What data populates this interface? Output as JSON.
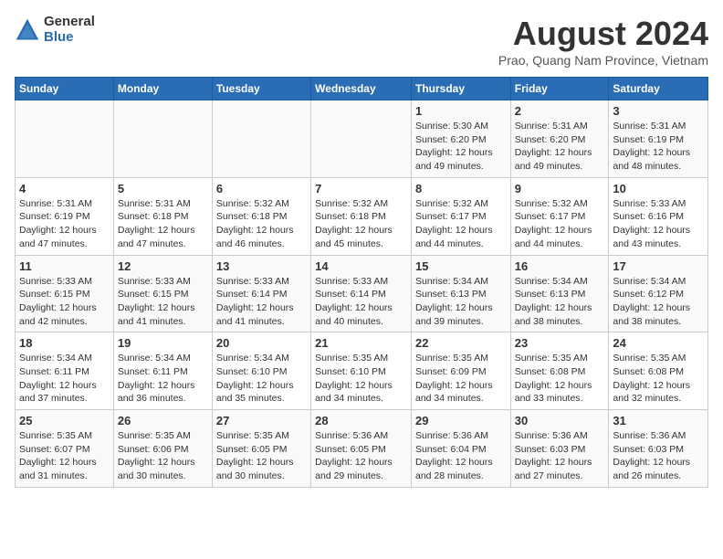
{
  "logo": {
    "general": "General",
    "blue": "Blue"
  },
  "title": "August 2024",
  "subtitle": "Prao, Quang Nam Province, Vietnam",
  "days_of_week": [
    "Sunday",
    "Monday",
    "Tuesday",
    "Wednesday",
    "Thursday",
    "Friday",
    "Saturday"
  ],
  "weeks": [
    [
      {
        "day": "",
        "info": ""
      },
      {
        "day": "",
        "info": ""
      },
      {
        "day": "",
        "info": ""
      },
      {
        "day": "",
        "info": ""
      },
      {
        "day": "1",
        "info": "Sunrise: 5:30 AM\nSunset: 6:20 PM\nDaylight: 12 hours\nand 49 minutes."
      },
      {
        "day": "2",
        "info": "Sunrise: 5:31 AM\nSunset: 6:20 PM\nDaylight: 12 hours\nand 49 minutes."
      },
      {
        "day": "3",
        "info": "Sunrise: 5:31 AM\nSunset: 6:19 PM\nDaylight: 12 hours\nand 48 minutes."
      }
    ],
    [
      {
        "day": "4",
        "info": "Sunrise: 5:31 AM\nSunset: 6:19 PM\nDaylight: 12 hours\nand 47 minutes."
      },
      {
        "day": "5",
        "info": "Sunrise: 5:31 AM\nSunset: 6:18 PM\nDaylight: 12 hours\nand 47 minutes."
      },
      {
        "day": "6",
        "info": "Sunrise: 5:32 AM\nSunset: 6:18 PM\nDaylight: 12 hours\nand 46 minutes."
      },
      {
        "day": "7",
        "info": "Sunrise: 5:32 AM\nSunset: 6:18 PM\nDaylight: 12 hours\nand 45 minutes."
      },
      {
        "day": "8",
        "info": "Sunrise: 5:32 AM\nSunset: 6:17 PM\nDaylight: 12 hours\nand 44 minutes."
      },
      {
        "day": "9",
        "info": "Sunrise: 5:32 AM\nSunset: 6:17 PM\nDaylight: 12 hours\nand 44 minutes."
      },
      {
        "day": "10",
        "info": "Sunrise: 5:33 AM\nSunset: 6:16 PM\nDaylight: 12 hours\nand 43 minutes."
      }
    ],
    [
      {
        "day": "11",
        "info": "Sunrise: 5:33 AM\nSunset: 6:15 PM\nDaylight: 12 hours\nand 42 minutes."
      },
      {
        "day": "12",
        "info": "Sunrise: 5:33 AM\nSunset: 6:15 PM\nDaylight: 12 hours\nand 41 minutes."
      },
      {
        "day": "13",
        "info": "Sunrise: 5:33 AM\nSunset: 6:14 PM\nDaylight: 12 hours\nand 41 minutes."
      },
      {
        "day": "14",
        "info": "Sunrise: 5:33 AM\nSunset: 6:14 PM\nDaylight: 12 hours\nand 40 minutes."
      },
      {
        "day": "15",
        "info": "Sunrise: 5:34 AM\nSunset: 6:13 PM\nDaylight: 12 hours\nand 39 minutes."
      },
      {
        "day": "16",
        "info": "Sunrise: 5:34 AM\nSunset: 6:13 PM\nDaylight: 12 hours\nand 38 minutes."
      },
      {
        "day": "17",
        "info": "Sunrise: 5:34 AM\nSunset: 6:12 PM\nDaylight: 12 hours\nand 38 minutes."
      }
    ],
    [
      {
        "day": "18",
        "info": "Sunrise: 5:34 AM\nSunset: 6:11 PM\nDaylight: 12 hours\nand 37 minutes."
      },
      {
        "day": "19",
        "info": "Sunrise: 5:34 AM\nSunset: 6:11 PM\nDaylight: 12 hours\nand 36 minutes."
      },
      {
        "day": "20",
        "info": "Sunrise: 5:34 AM\nSunset: 6:10 PM\nDaylight: 12 hours\nand 35 minutes."
      },
      {
        "day": "21",
        "info": "Sunrise: 5:35 AM\nSunset: 6:10 PM\nDaylight: 12 hours\nand 34 minutes."
      },
      {
        "day": "22",
        "info": "Sunrise: 5:35 AM\nSunset: 6:09 PM\nDaylight: 12 hours\nand 34 minutes."
      },
      {
        "day": "23",
        "info": "Sunrise: 5:35 AM\nSunset: 6:08 PM\nDaylight: 12 hours\nand 33 minutes."
      },
      {
        "day": "24",
        "info": "Sunrise: 5:35 AM\nSunset: 6:08 PM\nDaylight: 12 hours\nand 32 minutes."
      }
    ],
    [
      {
        "day": "25",
        "info": "Sunrise: 5:35 AM\nSunset: 6:07 PM\nDaylight: 12 hours\nand 31 minutes."
      },
      {
        "day": "26",
        "info": "Sunrise: 5:35 AM\nSunset: 6:06 PM\nDaylight: 12 hours\nand 30 minutes."
      },
      {
        "day": "27",
        "info": "Sunrise: 5:35 AM\nSunset: 6:05 PM\nDaylight: 12 hours\nand 30 minutes."
      },
      {
        "day": "28",
        "info": "Sunrise: 5:36 AM\nSunset: 6:05 PM\nDaylight: 12 hours\nand 29 minutes."
      },
      {
        "day": "29",
        "info": "Sunrise: 5:36 AM\nSunset: 6:04 PM\nDaylight: 12 hours\nand 28 minutes."
      },
      {
        "day": "30",
        "info": "Sunrise: 5:36 AM\nSunset: 6:03 PM\nDaylight: 12 hours\nand 27 minutes."
      },
      {
        "day": "31",
        "info": "Sunrise: 5:36 AM\nSunset: 6:03 PM\nDaylight: 12 hours\nand 26 minutes."
      }
    ]
  ]
}
